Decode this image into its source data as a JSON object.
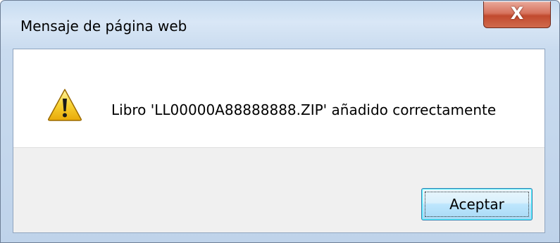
{
  "window": {
    "title": "Mensaje de página web",
    "close_glyph": "X"
  },
  "message": {
    "icon": "warning-icon",
    "text": "Libro 'LL00000A88888888.ZIP' añadido correctamente"
  },
  "buttons": {
    "accept_label": "Aceptar"
  },
  "colors": {
    "titlebar_bg": "#c7dcf1",
    "close_button": "#c14a2f",
    "button_area_bg": "#f0f0f0",
    "warning_yellow": "#f5c21b"
  }
}
